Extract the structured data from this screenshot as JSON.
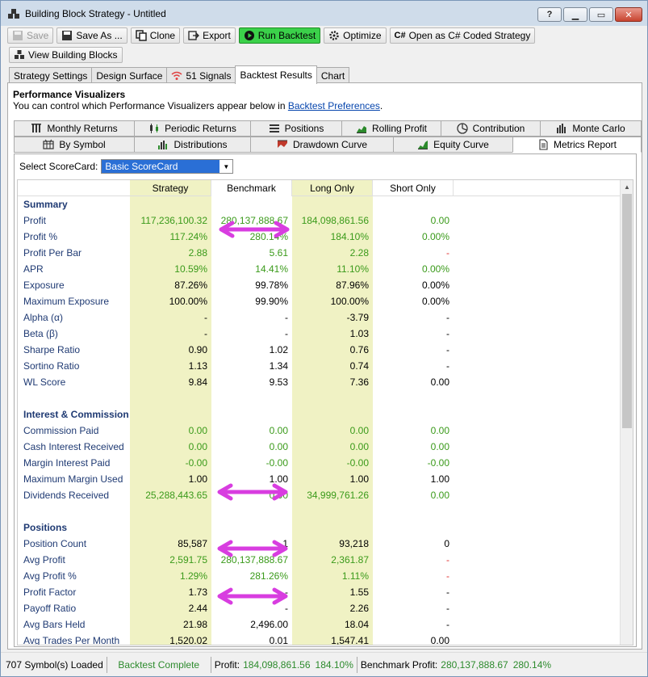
{
  "window": {
    "title": "Building Block Strategy - Untitled",
    "help": "?",
    "minimize": "▭",
    "maximize": "▢",
    "close": "✕"
  },
  "toolbar": {
    "save": "Save",
    "save_as": "Save As ...",
    "clone": "Clone",
    "export": "Export",
    "run_backtest": "Run Backtest",
    "optimize": "Optimize",
    "open_csharp": "Open as C# Coded Strategy",
    "view_blocks": "View Building Blocks"
  },
  "main_tabs": [
    "Strategy Settings",
    "Design Surface",
    "51 Signals",
    "Backtest Results",
    "Chart"
  ],
  "active_main_tab": "Backtest Results",
  "visualizers": {
    "title": "Performance Visualizers",
    "subtitle_prefix": "You can control which Performance Visualizers appear below in ",
    "link": "Backtest Preferences",
    "subtitle_suffix": ".",
    "tabs_row1": [
      "Monthly Returns",
      "Periodic Returns",
      "Positions",
      "Rolling Profit",
      "Contribution",
      "Monte Carlo"
    ],
    "tabs_row2": [
      "By Symbol",
      "Distributions",
      "Drawdown Curve",
      "Equity Curve",
      "Metrics Report"
    ],
    "active": "Metrics Report"
  },
  "scorecard": {
    "label": "Select ScoreCard:",
    "value": "Basic ScoreCard"
  },
  "columns": [
    "Strategy",
    "Benchmark",
    "Long Only",
    "Short Only"
  ],
  "sections": [
    {
      "title": "Summary",
      "rows": [
        {
          "label": "Profit",
          "v": [
            "117,236,100.32",
            "280,137,888.67",
            "184,098,861.56",
            "0.00"
          ],
          "c": [
            "green",
            "green",
            "green",
            "green"
          ]
        },
        {
          "label": "Profit %",
          "v": [
            "117.24%",
            "280.14%",
            "184.10%",
            "0.00%"
          ],
          "c": [
            "green",
            "green",
            "green",
            "green"
          ]
        },
        {
          "label": "Profit Per Bar",
          "v": [
            "2.88",
            "5.61",
            "2.28",
            "-"
          ],
          "c": [
            "green",
            "green",
            "green",
            "red"
          ]
        },
        {
          "label": "APR",
          "v": [
            "10.59%",
            "14.41%",
            "11.10%",
            "0.00%"
          ],
          "c": [
            "green",
            "green",
            "green",
            "green"
          ]
        },
        {
          "label": "Exposure",
          "v": [
            "87.26%",
            "99.78%",
            "87.96%",
            "0.00%"
          ],
          "c": [
            "black",
            "black",
            "black",
            "black"
          ]
        },
        {
          "label": "Maximum Exposure",
          "v": [
            "100.00%",
            "99.90%",
            "100.00%",
            "0.00%"
          ],
          "c": [
            "black",
            "black",
            "black",
            "black"
          ]
        },
        {
          "label": "Alpha (α)",
          "v": [
            "-",
            "-",
            "-3.79",
            "-"
          ],
          "c": [
            "black",
            "black",
            "black",
            "black"
          ]
        },
        {
          "label": "Beta (β)",
          "v": [
            "-",
            "-",
            "1.03",
            "-"
          ],
          "c": [
            "black",
            "black",
            "black",
            "black"
          ]
        },
        {
          "label": "Sharpe Ratio",
          "v": [
            "0.90",
            "1.02",
            "0.76",
            "-"
          ],
          "c": [
            "black",
            "black",
            "black",
            "black"
          ]
        },
        {
          "label": "Sortino Ratio",
          "v": [
            "1.13",
            "1.34",
            "0.74",
            "-"
          ],
          "c": [
            "black",
            "black",
            "black",
            "black"
          ]
        },
        {
          "label": "WL Score",
          "v": [
            "9.84",
            "9.53",
            "7.36",
            "0.00"
          ],
          "c": [
            "black",
            "black",
            "black",
            "black"
          ]
        }
      ]
    },
    {
      "title": "Interest & Commission",
      "rows": [
        {
          "label": "Commission Paid",
          "v": [
            "0.00",
            "0.00",
            "0.00",
            "0.00"
          ],
          "c": [
            "green",
            "green",
            "green",
            "green"
          ]
        },
        {
          "label": "Cash Interest Received",
          "v": [
            "0.00",
            "0.00",
            "0.00",
            "0.00"
          ],
          "c": [
            "green",
            "green",
            "green",
            "green"
          ]
        },
        {
          "label": "Margin Interest Paid",
          "v": [
            "-0.00",
            "-0.00",
            "-0.00",
            "-0.00"
          ],
          "c": [
            "green",
            "green",
            "green",
            "green"
          ]
        },
        {
          "label": "Maximum Margin Used",
          "v": [
            "1.00",
            "1.00",
            "1.00",
            "1.00"
          ],
          "c": [
            "black",
            "black",
            "black",
            "black"
          ]
        },
        {
          "label": "Dividends Received",
          "v": [
            "25,288,443.65",
            "0.00",
            "34,999,761.26",
            "0.00"
          ],
          "c": [
            "green",
            "green",
            "green",
            "green"
          ]
        }
      ]
    },
    {
      "title": "Positions",
      "rows": [
        {
          "label": "Position Count",
          "v": [
            "85,587",
            "1",
            "93,218",
            "0"
          ],
          "c": [
            "black",
            "black",
            "black",
            "black"
          ]
        },
        {
          "label": "Avg Profit",
          "v": [
            "2,591.75",
            "280,137,888.67",
            "2,361.87",
            "-"
          ],
          "c": [
            "green",
            "green",
            "green",
            "red"
          ]
        },
        {
          "label": "Avg Profit %",
          "v": [
            "1.29%",
            "281.26%",
            "1.11%",
            "-"
          ],
          "c": [
            "green",
            "green",
            "green",
            "red"
          ]
        },
        {
          "label": "Profit Factor",
          "v": [
            "1.73",
            "-",
            "1.55",
            "-"
          ],
          "c": [
            "black",
            "black",
            "black",
            "black"
          ]
        },
        {
          "label": "Payoff Ratio",
          "v": [
            "2.44",
            "-",
            "2.26",
            "-"
          ],
          "c": [
            "black",
            "black",
            "black",
            "black"
          ]
        },
        {
          "label": "Avg Bars Held",
          "v": [
            "21.98",
            "2,496.00",
            "18.04",
            "-"
          ],
          "c": [
            "black",
            "black",
            "black",
            "black"
          ]
        },
        {
          "label": "Avg Trades Per Month",
          "v": [
            "1,520.02",
            "0.01",
            "1,547.41",
            "0.00"
          ],
          "c": [
            "black",
            "black",
            "black",
            "black"
          ]
        }
      ]
    }
  ],
  "status": {
    "symbols": "707 Symbol(s) Loaded",
    "state": "Backtest Complete",
    "profit_label": "Profit:",
    "profit_value": "184,098,861.56",
    "profit_pct": "184.10%",
    "bench_label": "Benchmark Profit:",
    "bench_value": "280,137,888.67",
    "bench_pct": "280.14%"
  },
  "colors": {
    "highlight": "#f0f2c4",
    "green": "#3a9a1a",
    "label": "#1f3a73",
    "annotation": "#d83de0",
    "run": "#3bd14a"
  }
}
